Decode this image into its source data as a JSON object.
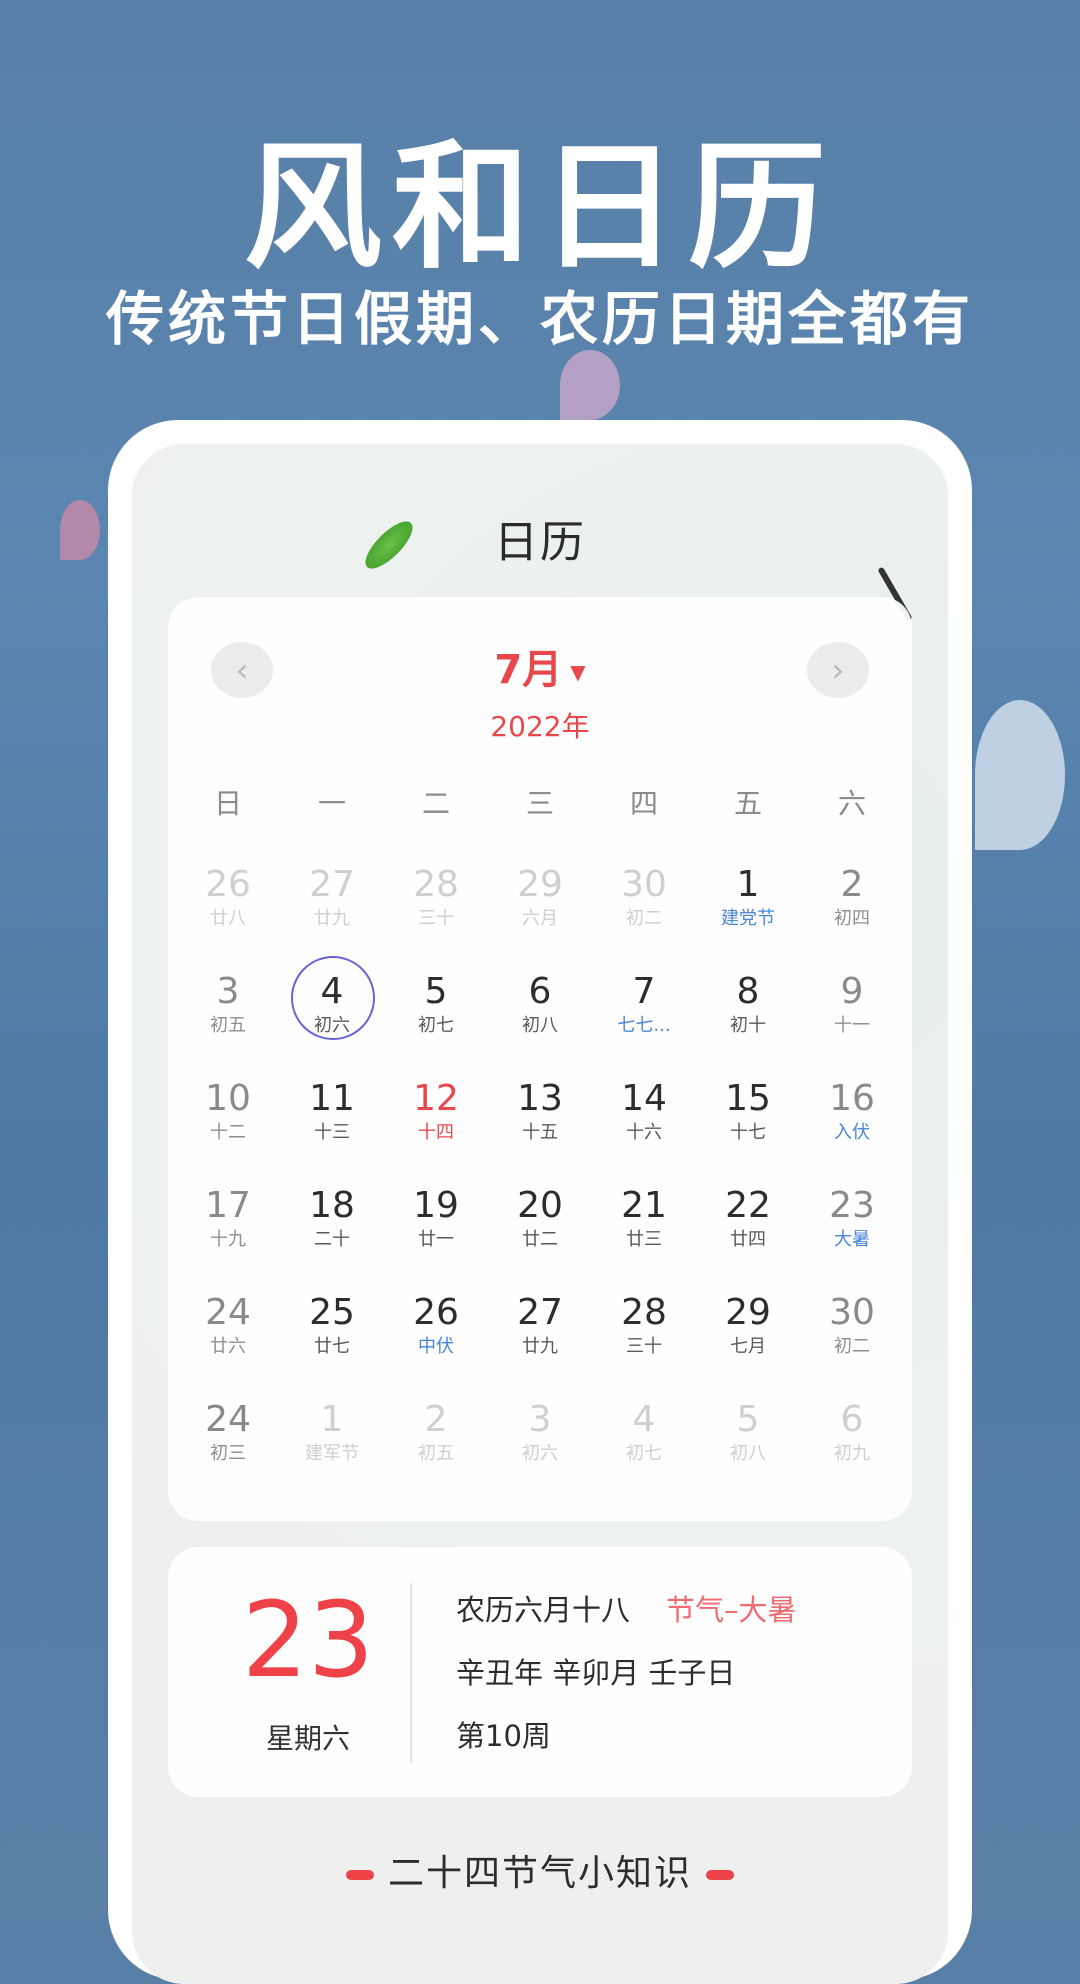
{
  "hero": {
    "title": "风和日历",
    "subtitle": "传统节日假期、农历日期全都有"
  },
  "app": {
    "title": "日历",
    "icons": {
      "leaf": "leaf-decoration",
      "prev": "chevron-left-icon",
      "next": "chevron-right-icon",
      "month_dropdown": "caret-down-icon"
    }
  },
  "calendar": {
    "prev_label": "‹",
    "next_label": "›",
    "month": "7月",
    "caret": "▼",
    "year": "2022年",
    "weekdays": [
      "日",
      "一",
      "二",
      "三",
      "四",
      "五",
      "六"
    ],
    "selected_day": "4",
    "weeks": [
      [
        {
          "day": "26",
          "lunar": "廿八",
          "type": "other"
        },
        {
          "day": "27",
          "lunar": "廿九",
          "type": "other"
        },
        {
          "day": "28",
          "lunar": "三十",
          "type": "other"
        },
        {
          "day": "29",
          "lunar": "六月",
          "type": "other"
        },
        {
          "day": "30",
          "lunar": "初二",
          "type": "other"
        },
        {
          "day": "1",
          "lunar": "建党节",
          "type": "festival"
        },
        {
          "day": "2",
          "lunar": "初四",
          "type": "weekend"
        }
      ],
      [
        {
          "day": "3",
          "lunar": "初五",
          "type": "weekend"
        },
        {
          "day": "4",
          "lunar": "初六",
          "type": "today"
        },
        {
          "day": "5",
          "lunar": "初七",
          "type": "normal"
        },
        {
          "day": "6",
          "lunar": "初八",
          "type": "normal"
        },
        {
          "day": "7",
          "lunar": "七七...",
          "type": "festival"
        },
        {
          "day": "8",
          "lunar": "初十",
          "type": "normal"
        },
        {
          "day": "9",
          "lunar": "十一",
          "type": "weekend"
        }
      ],
      [
        {
          "day": "10",
          "lunar": "十二",
          "type": "weekend"
        },
        {
          "day": "11",
          "lunar": "十三",
          "type": "normal"
        },
        {
          "day": "12",
          "lunar": "十四",
          "type": "red"
        },
        {
          "day": "13",
          "lunar": "十五",
          "type": "normal"
        },
        {
          "day": "14",
          "lunar": "十六",
          "type": "normal"
        },
        {
          "day": "15",
          "lunar": "十七",
          "type": "normal"
        },
        {
          "day": "16",
          "lunar": "入伏",
          "type": "weekend-festival"
        }
      ],
      [
        {
          "day": "17",
          "lunar": "十九",
          "type": "weekend"
        },
        {
          "day": "18",
          "lunar": "二十",
          "type": "normal"
        },
        {
          "day": "19",
          "lunar": "廿一",
          "type": "normal"
        },
        {
          "day": "20",
          "lunar": "廿二",
          "type": "normal"
        },
        {
          "day": "21",
          "lunar": "廿三",
          "type": "normal"
        },
        {
          "day": "22",
          "lunar": "廿四",
          "type": "normal"
        },
        {
          "day": "23",
          "lunar": "大暑",
          "type": "weekend-festival"
        }
      ],
      [
        {
          "day": "24",
          "lunar": "廿六",
          "type": "weekend"
        },
        {
          "day": "25",
          "lunar": "廿七",
          "type": "normal"
        },
        {
          "day": "26",
          "lunar": "中伏",
          "type": "festival"
        },
        {
          "day": "27",
          "lunar": "廿九",
          "type": "normal"
        },
        {
          "day": "28",
          "lunar": "三十",
          "type": "normal"
        },
        {
          "day": "29",
          "lunar": "七月",
          "type": "normal"
        },
        {
          "day": "30",
          "lunar": "初二",
          "type": "weekend"
        }
      ],
      [
        {
          "day": "24",
          "lunar": "初三",
          "type": "other-dark"
        },
        {
          "day": "1",
          "lunar": "建军节",
          "type": "other"
        },
        {
          "day": "2",
          "lunar": "初五",
          "type": "other"
        },
        {
          "day": "3",
          "lunar": "初六",
          "type": "other"
        },
        {
          "day": "4",
          "lunar": "初七",
          "type": "other"
        },
        {
          "day": "5",
          "lunar": "初八",
          "type": "other"
        },
        {
          "day": "6",
          "lunar": "初九",
          "type": "other"
        }
      ]
    ]
  },
  "detail": {
    "day": "23",
    "weekday": "星期六",
    "lunar_date": "农历六月十八",
    "solar_term": "节气–大暑",
    "ganzhi": "辛丑年 辛卯月 壬子日",
    "week_number": "第10周"
  },
  "section": {
    "title": "二十四节气小知识"
  },
  "colors": {
    "accent_red": "#e8484b",
    "festival_blue": "#4a86d6",
    "today_ring": "#6a63d4",
    "background_blue": "#5a86b1"
  }
}
